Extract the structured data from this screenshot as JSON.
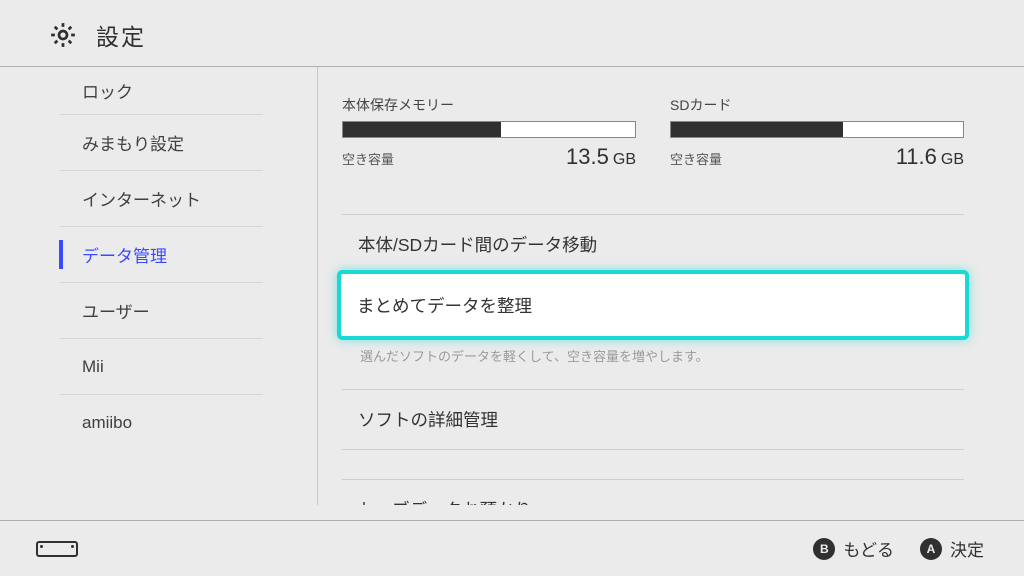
{
  "header": {
    "title": "設定"
  },
  "sidebar": {
    "items": [
      {
        "label": "ロック"
      },
      {
        "label": "みまもり設定"
      },
      {
        "label": "インターネット"
      },
      {
        "label": "データ管理",
        "active": true
      },
      {
        "label": "ユーザー"
      },
      {
        "label": "Mii"
      },
      {
        "label": "amiibo"
      }
    ]
  },
  "storage": [
    {
      "title": "本体保存メモリー",
      "free_label": "空き容量",
      "free_value": "13.5",
      "unit": "GB",
      "fill_pct": 54
    },
    {
      "title": "SDカード",
      "free_label": "空き容量",
      "free_value": "11.6",
      "unit": "GB",
      "fill_pct": 59
    }
  ],
  "options": [
    {
      "label": "本体/SDカード間のデータ移動"
    },
    {
      "label": "まとめてデータを整理",
      "selected": true,
      "caption": "選んだソフトのデータを軽くして、空き容量を増やします。"
    },
    {
      "label": "ソフトの詳細管理"
    },
    {
      "label": "セーブデータお預かり"
    }
  ],
  "footer": {
    "back": {
      "button": "B",
      "label": "もどる"
    },
    "confirm": {
      "button": "A",
      "label": "決定"
    }
  }
}
